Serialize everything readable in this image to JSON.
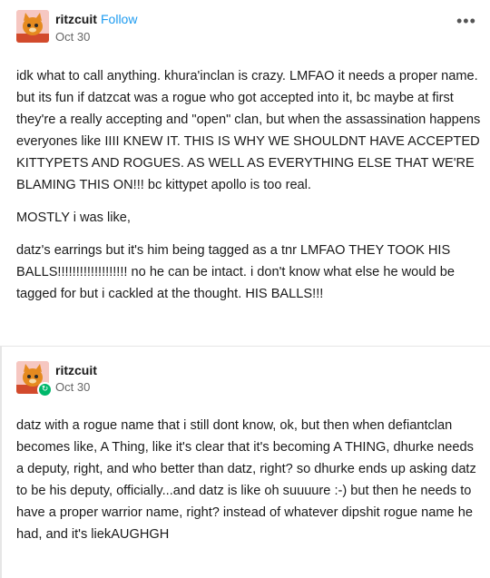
{
  "post1": {
    "username": "ritzcuit",
    "follow_label": "Follow",
    "date": "Oct 30",
    "more_label": "•••",
    "paragraphs": [
      "idk what to call anything. khura'inclan is crazy. LMFAO it needs a proper name. but its fun if datzcat was a rogue who got accepted into it, bc maybe at first they're a really accepting and \"open\" clan, but when the assassination happens everyones like IIII KNEW IT. THIS IS WHY WE SHOULDNT HAVE ACCEPTED KITTYPETS AND ROGUES. AS WELL AS EVERYTHING ELSE THAT WE'RE BLAMING THIS ON!!! bc kittypet apollo is too real.",
      "MOSTLY i was like,",
      "datz's earrings but it's him being tagged as a tnr LMFAO THEY TOOK HIS BALLS!!!!!!!!!!!!!!!!!!! no he can be intact. i don't know what else he would be tagged for but i cackled at the thought. HIS BALLS!!!"
    ]
  },
  "post2": {
    "username": "ritzcuit",
    "date": "Oct 30",
    "badge_icon": "↻",
    "paragraphs": [
      "datz with a rogue name that i still dont know, ok, but then when defiantclan becomes like, A Thing, like it's clear that it's becoming A THING, dhurke needs a deputy, right, and who better than datz, right? so dhurke ends up asking datz to be his deputy, officially...and datz is like oh suuuure :-) but then he needs to have a proper warrior name, right? instead of whatever dipshit rogue name he had, and it's liekAUGHGH"
    ]
  },
  "colors": {
    "link": "#1d9bf0",
    "badge": "#00b86b",
    "avatar_bg": "#f6c7c1"
  }
}
